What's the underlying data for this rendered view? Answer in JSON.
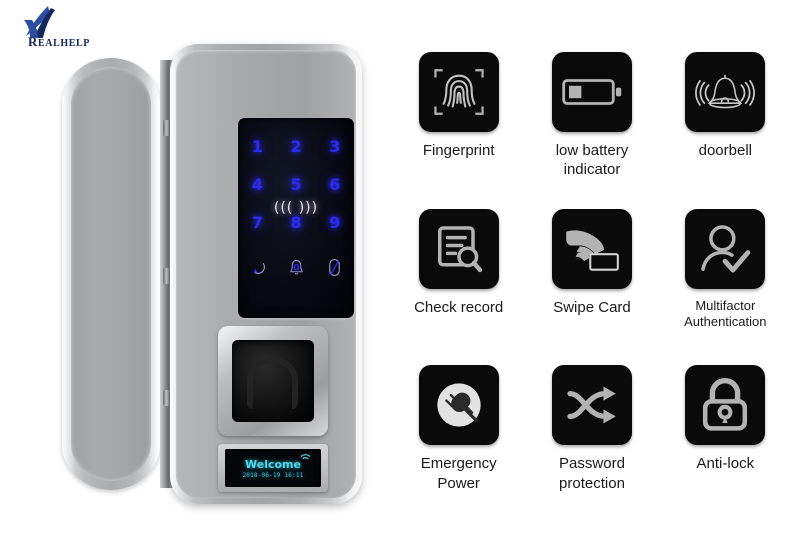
{
  "brand": {
    "name": "REALHELP",
    "initial": "R",
    "rest": "EALHELP",
    "color": "#1f3f8f"
  },
  "product": {
    "name": "glass-door-smart-lock",
    "keypad": {
      "rows": [
        [
          "1",
          "2",
          "3"
        ],
        [
          "4",
          "5",
          "6"
        ],
        [
          "7",
          "8",
          "9"
        ]
      ],
      "nfc_symbol": "((( )))",
      "function_keys": [
        "back-key",
        "bell-key",
        "key-key"
      ]
    },
    "display": {
      "greeting": "Welcome",
      "timestamp": "2018-06-19  16:11"
    },
    "sensor_label": "fingerprint-reader"
  },
  "features": [
    {
      "id": "fingerprint",
      "icon": "fingerprint-icon",
      "label": "Fingerprint"
    },
    {
      "id": "low-battery",
      "icon": "low-battery-icon",
      "label": "low battery indicator"
    },
    {
      "id": "doorbell",
      "icon": "doorbell-icon",
      "label": "doorbell"
    },
    {
      "id": "check-record",
      "icon": "document-search-icon",
      "label": "Check record"
    },
    {
      "id": "swipe-card",
      "icon": "swipe-card-icon",
      "label": "Swipe Card"
    },
    {
      "id": "multifactor",
      "icon": "user-check-icon",
      "label": "Multifactor Authentication"
    },
    {
      "id": "emergency-power",
      "icon": "power-plug-icon",
      "label": "Emergency Power"
    },
    {
      "id": "password",
      "icon": "shuffle-arrows-icon",
      "label": "Password protection"
    },
    {
      "id": "anti-lock",
      "icon": "padlock-icon",
      "label": "Anti-lock"
    }
  ],
  "colors": {
    "background": "#ffffff",
    "tile": "#0a0a0a",
    "icon_gray": "#b3b3b3",
    "keypad_blue": "#2b2bf0",
    "oled_cyan": "#4fd8e8",
    "caption": "#1a1a1a"
  }
}
